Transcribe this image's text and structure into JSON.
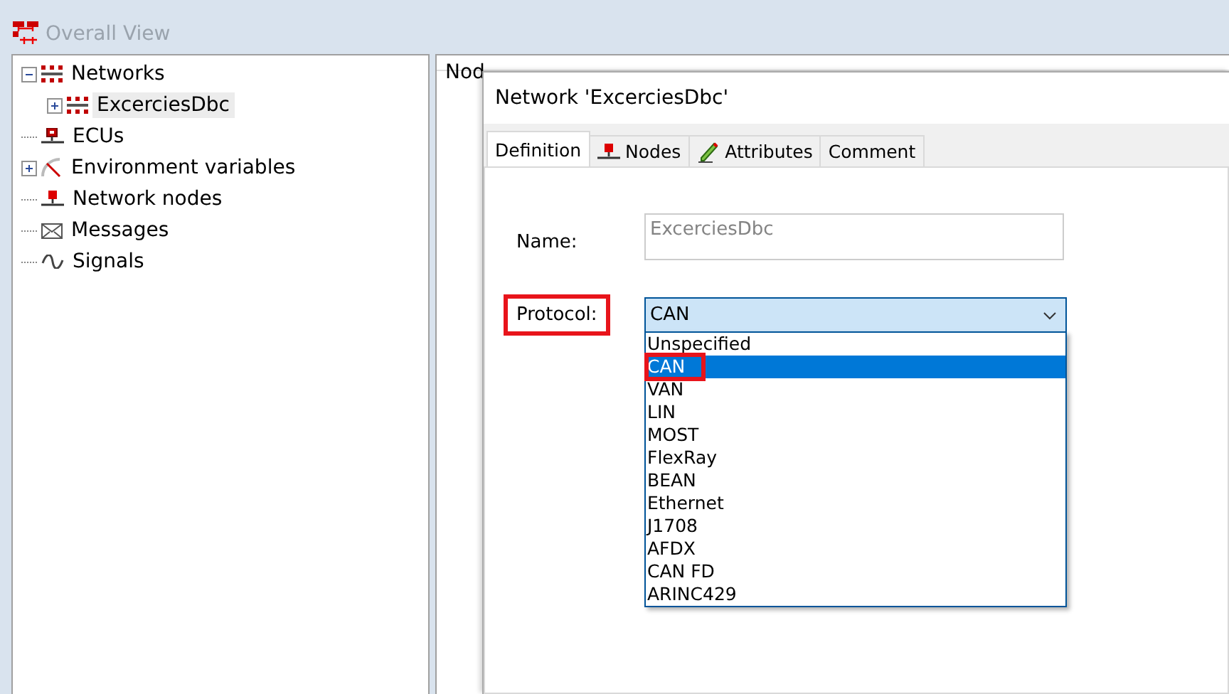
{
  "window": {
    "title": "Overall View"
  },
  "tree": [
    {
      "label": "Networks",
      "kind": "network",
      "expanded": true,
      "selected": false,
      "children": [
        {
          "label": "ExcerciesDbc",
          "kind": "network",
          "expanded": false,
          "selected": true
        }
      ]
    },
    {
      "label": "ECUs",
      "kind": "ecu",
      "selected": false
    },
    {
      "label": "Environment variables",
      "kind": "envvar",
      "expanded": false,
      "selected": false
    },
    {
      "label": "Network nodes",
      "kind": "node",
      "selected": false
    },
    {
      "label": "Messages",
      "kind": "message",
      "selected": false
    },
    {
      "label": "Signals",
      "kind": "signal",
      "selected": false
    }
  ],
  "list": {
    "columns": [
      "Nod"
    ]
  },
  "dialog": {
    "title": "Network 'ExcerciesDbc'",
    "tabs": [
      {
        "label": "Definition",
        "kind": "plain",
        "selected": true
      },
      {
        "label": "Nodes",
        "kind": "node",
        "selected": false
      },
      {
        "label": "Attributes",
        "kind": "attr",
        "selected": false
      },
      {
        "label": "Comment",
        "kind": "plain",
        "selected": false
      }
    ],
    "name": {
      "label": "Name:",
      "value": "ExcerciesDbc",
      "disabled": true
    },
    "protocol": {
      "label": "Protocol:",
      "highlighted": true,
      "value": "CAN",
      "options": [
        {
          "label": "Unspecified",
          "selected": false,
          "highlighted": false
        },
        {
          "label": "CAN",
          "selected": true,
          "highlighted": true
        },
        {
          "label": "VAN",
          "selected": false,
          "highlighted": false
        },
        {
          "label": "LIN",
          "selected": false,
          "highlighted": false
        },
        {
          "label": "MOST",
          "selected": false,
          "highlighted": false
        },
        {
          "label": "FlexRay",
          "selected": false,
          "highlighted": false
        },
        {
          "label": "BEAN",
          "selected": false,
          "highlighted": false
        },
        {
          "label": "Ethernet",
          "selected": false,
          "highlighted": false
        },
        {
          "label": "J1708",
          "selected": false,
          "highlighted": false
        },
        {
          "label": "AFDX",
          "selected": false,
          "highlighted": false
        },
        {
          "label": "CAN FD",
          "selected": false,
          "highlighted": false
        },
        {
          "label": "ARINC429",
          "selected": false,
          "highlighted": false
        }
      ]
    }
  }
}
